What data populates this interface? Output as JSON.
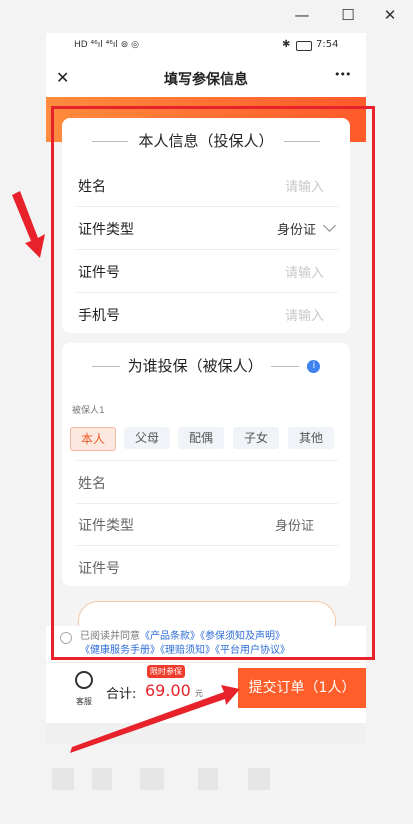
{
  "window": {
    "minimize": "—",
    "maximize": "☐",
    "close": "✕"
  },
  "status": {
    "left_icons": "HD ⁴⁶ıl ⁴⁶ıl ⊚ ◎",
    "bt": "✱",
    "time": "7:54"
  },
  "header": {
    "title": "填写参保信息",
    "close": "✕",
    "more": "•••"
  },
  "policyholder": {
    "section_title": "本人信息（投保人）",
    "rows": [
      {
        "label": "姓名",
        "placeholder": "请输入"
      },
      {
        "label": "证件类型",
        "value": "身份证"
      },
      {
        "label": "证件号",
        "placeholder": "请输入"
      },
      {
        "label": "手机号",
        "placeholder": "请输入"
      }
    ]
  },
  "insured": {
    "section_title": "为谁投保（被保人）",
    "info_icon": "i",
    "sub_label": "被保人1",
    "chips": [
      "本人",
      "父母",
      "配偶",
      "子女",
      "其他"
    ],
    "rows": [
      {
        "label": "姓名"
      },
      {
        "label": "证件类型",
        "value": "身份证"
      },
      {
        "label": "证件号"
      }
    ]
  },
  "agreement": {
    "prefix": "已阅读并同意",
    "links": [
      "《产品条款》",
      "《参保须知及声明》",
      "《健康服务手册》",
      "《理赔须知》",
      "《平台用户协议》"
    ]
  },
  "footer": {
    "service_label": "客服",
    "total_label": "合计:",
    "badge": "限时参保",
    "price": "69.00",
    "unit": "元",
    "submit": "提交订单（1人）"
  },
  "colors": {
    "accent": "#ff5e2a",
    "link": "#2e6ed8",
    "annotation": "#e8222a"
  }
}
